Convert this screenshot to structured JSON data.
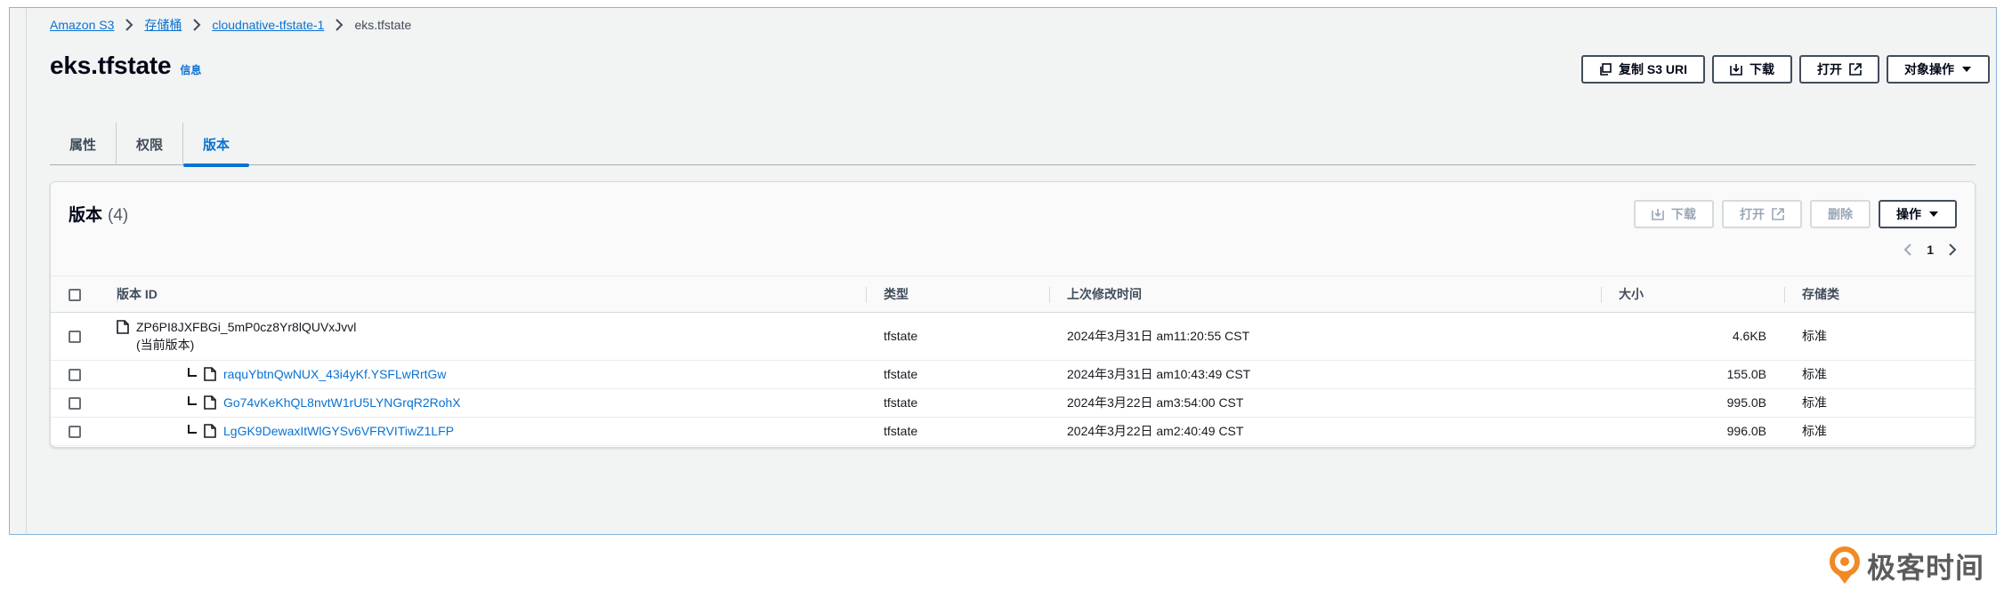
{
  "breadcrumb": {
    "items": [
      "Amazon S3",
      "存储桶",
      "cloudnative-tfstate-1"
    ],
    "current": "eks.tfstate"
  },
  "header": {
    "title": "eks.tfstate",
    "info": "信息",
    "actions": {
      "copy_uri": "复制 S3 URI",
      "download": "下载",
      "open": "打开",
      "object_actions": "对象操作"
    }
  },
  "tabs": [
    "属性",
    "权限",
    "版本"
  ],
  "active_tab": "版本",
  "versions": {
    "title": "版本",
    "count": "(4)",
    "actions": {
      "download": "下载",
      "open": "打开",
      "delete": "删除",
      "actions": "操作"
    },
    "pagination": {
      "page": "1"
    },
    "columns": [
      "版本 ID",
      "类型",
      "上次修改时间",
      "大小",
      "存储类"
    ],
    "rows": [
      {
        "id": "ZP6PI8JXFBGi_5mP0cz8Yr8lQUVxJvvl",
        "current_label": "(当前版本)",
        "type": "tfstate",
        "modified": "2024年3月31日 am11:20:55 CST",
        "size": "4.6KB",
        "storage_class": "标准"
      },
      {
        "id": "raquYbtnQwNUX_43i4yKf.YSFLwRrtGw",
        "type": "tfstate",
        "modified": "2024年3月31日 am10:43:49 CST",
        "size": "155.0B",
        "storage_class": "标准"
      },
      {
        "id": "Go74vKeKhQL8nvtW1rU5LYNGrqR2RohX",
        "type": "tfstate",
        "modified": "2024年3月22日 am3:54:00 CST",
        "size": "995.0B",
        "storage_class": "标准"
      },
      {
        "id": "LgGK9DewaxItWlGYSv6VFRVITiwZ1LFP",
        "type": "tfstate",
        "modified": "2024年3月22日 am2:40:49 CST",
        "size": "996.0B",
        "storage_class": "标准"
      }
    ]
  },
  "watermark": {
    "text": "极客时间"
  },
  "icons": {
    "breadcrumb_sep": "chevron-right-icon",
    "copy": "copy-icon",
    "download": "download-icon",
    "external": "external-link-icon",
    "dropdown": "caret-down-icon",
    "file": "file-icon",
    "prev": "chevron-left-icon",
    "next": "chevron-right-icon"
  },
  "colors": {
    "accent": "#0972d3",
    "background": "#f2f3f3",
    "logo_orange": "#f08a24"
  }
}
